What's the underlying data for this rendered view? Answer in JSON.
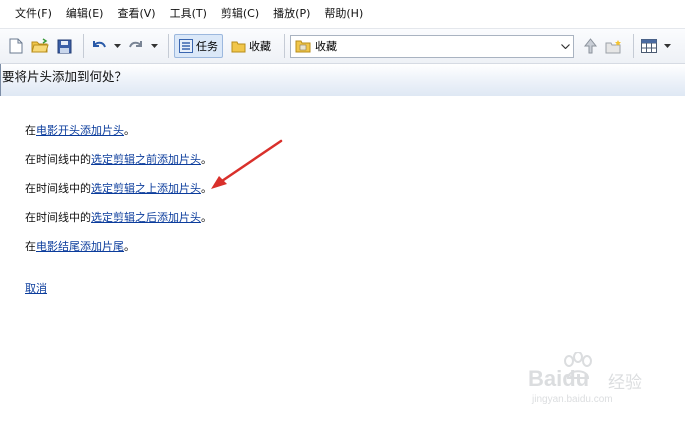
{
  "menu": [
    "文件(F)",
    "编辑(E)",
    "查看(V)",
    "工具(T)",
    "剪辑(C)",
    "播放(P)",
    "帮助(H)"
  ],
  "toolbar": {
    "tasks_label": "任务",
    "collections_label": "收藏",
    "collections_combo_value": "收藏"
  },
  "pane": {
    "title": "要将片头添加到何处？",
    "options": [
      {
        "prefix": "在",
        "link": "电影开头添加片头",
        "suffix": "。"
      },
      {
        "prefix": "在时间线中的",
        "link": "选定剪辑之前添加片头",
        "suffix": "。"
      },
      {
        "prefix": "在时间线中的",
        "link": "选定剪辑之上添加片头",
        "suffix": "。"
      },
      {
        "prefix": "在时间线中的",
        "link": "选定剪辑之后添加片头",
        "suffix": "。"
      },
      {
        "prefix": "在",
        "link": "电影结尾添加片尾",
        "suffix": "。"
      }
    ],
    "cancel": "取消"
  },
  "watermark": {
    "brand": "Baidu",
    "cn": "经验",
    "url": "jingyan.baidu.com"
  },
  "colors": {
    "link": "#0b3c9c",
    "arrow": "#d9302b"
  }
}
